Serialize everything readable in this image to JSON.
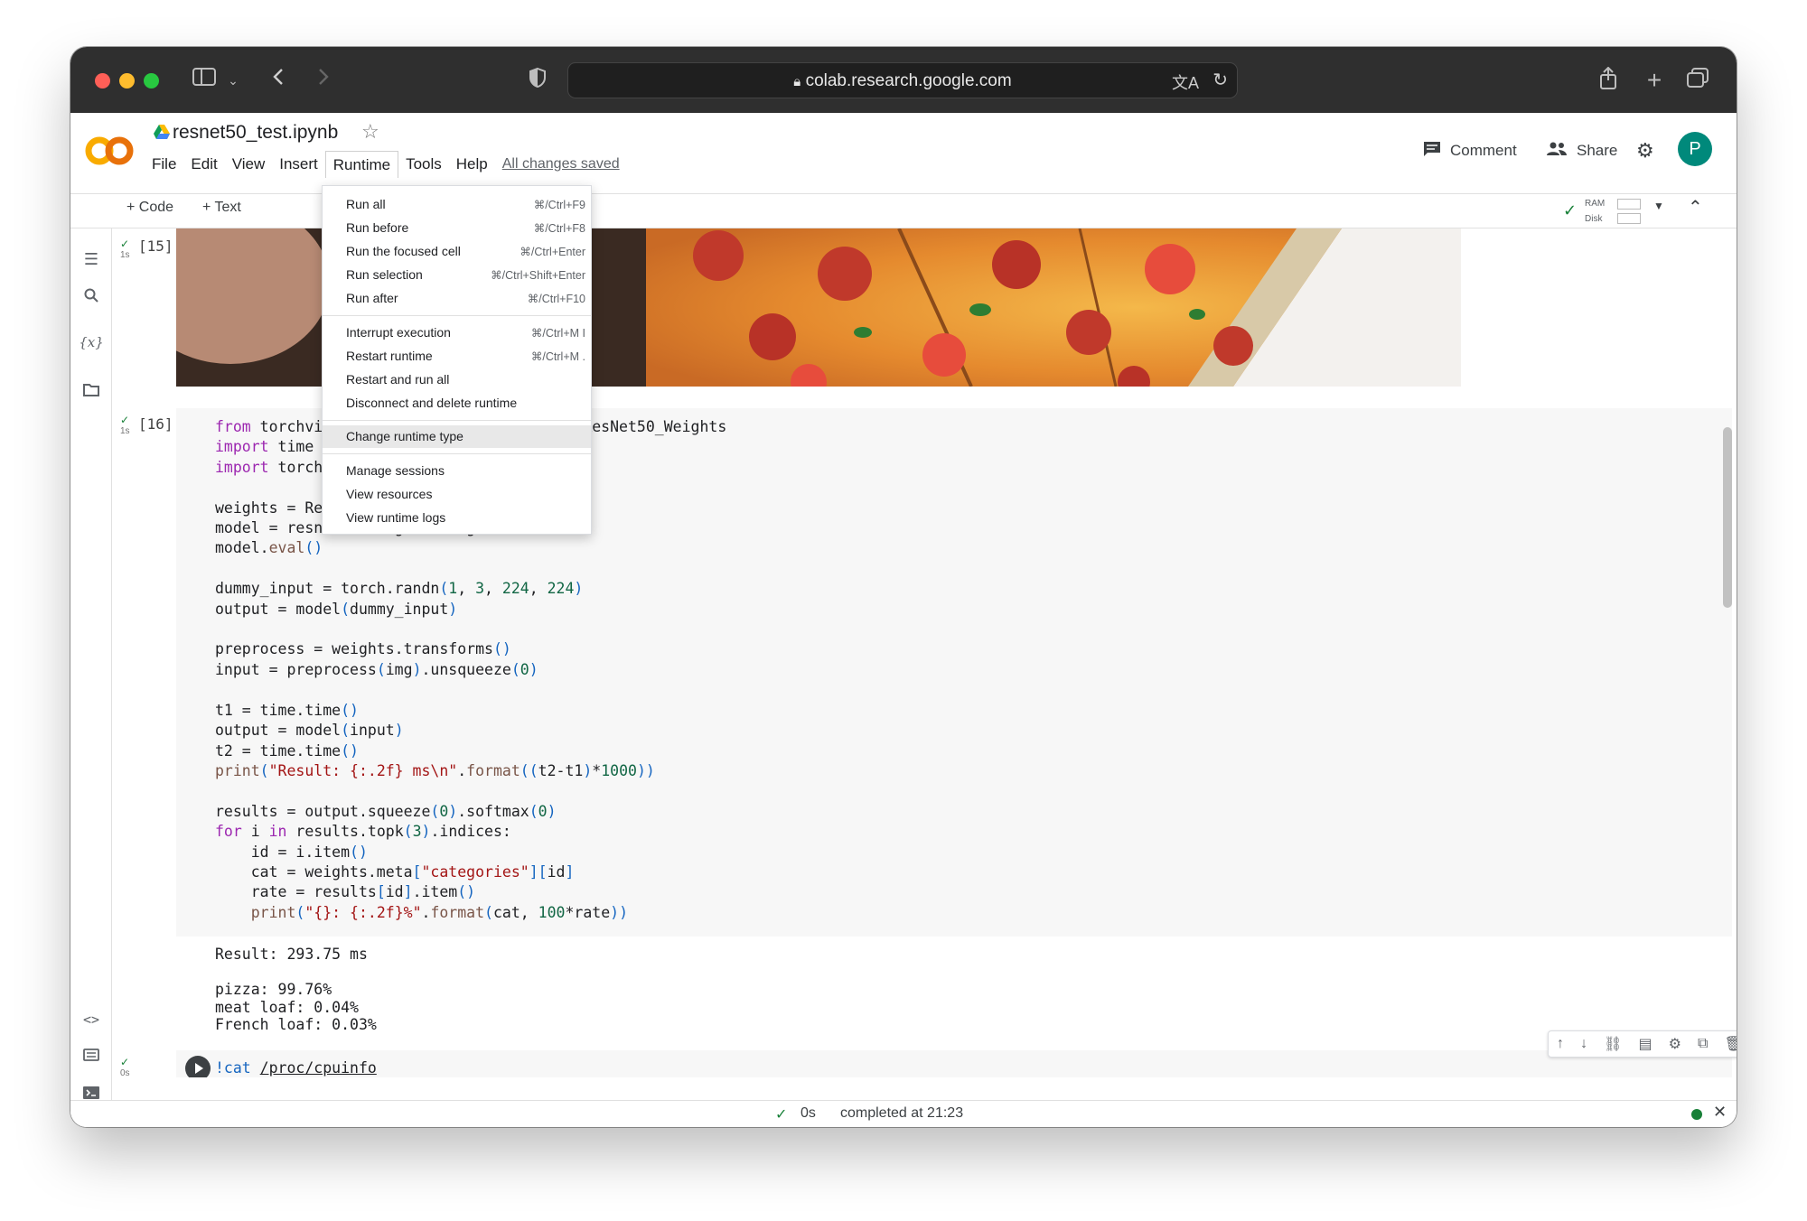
{
  "browser": {
    "url": "colab.research.google.com"
  },
  "notebook": {
    "title": "resnet50_test.ipynb",
    "menu": [
      "File",
      "Edit",
      "View",
      "Insert",
      "Runtime",
      "Tools",
      "Help"
    ],
    "saved_status": "All changes saved",
    "comment_label": "Comment",
    "share_label": "Share",
    "avatar_letter": "P"
  },
  "toolbar": {
    "code_label": "+ Code",
    "text_label": "+ Text",
    "ram_label": "RAM",
    "disk_label": "Disk"
  },
  "cells": {
    "cell15": {
      "count": "[15]",
      "time": "1s"
    },
    "cell16": {
      "count": "[16]",
      "time": "1s"
    },
    "cell17": {
      "time": "0s",
      "code_prefix": "!cat ",
      "code_path": "/proc/cpuinfo"
    }
  },
  "output_lines": [
    "Result: 293.75 ms",
    "",
    "pizza: 99.76%",
    "meat loaf: 0.04%",
    "French loaf: 0.03%"
  ],
  "runtime_menu": {
    "groups": [
      [
        {
          "label": "Run all",
          "shortcut": "⌘/Ctrl+F9"
        },
        {
          "label": "Run before",
          "shortcut": "⌘/Ctrl+F8"
        },
        {
          "label": "Run the focused cell",
          "shortcut": "⌘/Ctrl+Enter"
        },
        {
          "label": "Run selection",
          "shortcut": "⌘/Ctrl+Shift+Enter"
        },
        {
          "label": "Run after",
          "shortcut": "⌘/Ctrl+F10"
        }
      ],
      [
        {
          "label": "Interrupt execution",
          "shortcut": "⌘/Ctrl+M I"
        },
        {
          "label": "Restart runtime",
          "shortcut": "⌘/Ctrl+M ."
        },
        {
          "label": "Restart and run all",
          "shortcut": ""
        },
        {
          "label": "Disconnect and delete runtime",
          "shortcut": ""
        }
      ],
      [
        {
          "label": "Change runtime type",
          "shortcut": "",
          "highlighted": true
        }
      ],
      [
        {
          "label": "Manage sessions",
          "shortcut": ""
        },
        {
          "label": "View resources",
          "shortcut": ""
        },
        {
          "label": "View runtime logs",
          "shortcut": ""
        }
      ]
    ]
  },
  "status_bar": {
    "time": "0s",
    "message": "completed at 21:23"
  },
  "colors": {
    "accent_check": "#188038",
    "colab_orange": "#f9ab00",
    "avatar": "#00897b"
  }
}
